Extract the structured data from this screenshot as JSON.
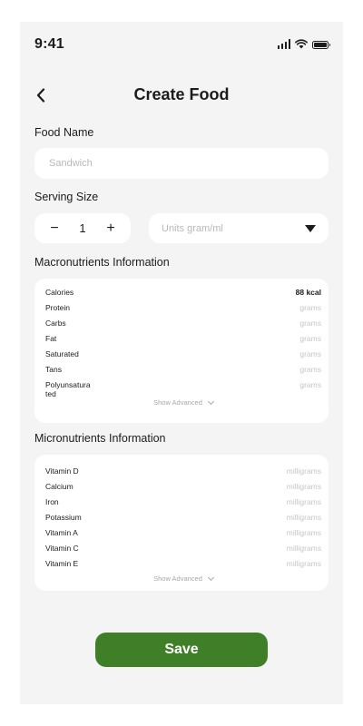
{
  "status_bar": {
    "time": "9:41"
  },
  "header": {
    "title": "Create Food"
  },
  "food_name": {
    "label": "Food Name",
    "placeholder": "Sandwich",
    "value": ""
  },
  "serving_size": {
    "label": "Serving Size",
    "decrement": "−",
    "quantity": "1",
    "increment": "+",
    "unit_placeholder": "Units gram/ml"
  },
  "macronutrients": {
    "label": "Macronutrients Information",
    "rows": [
      {
        "name": "Calories",
        "unit": "88 kcal"
      },
      {
        "name": "Protein",
        "unit": "grams"
      },
      {
        "name": "Carbs",
        "unit": "grams"
      },
      {
        "name": "Fat",
        "unit": "grams"
      },
      {
        "name": "Saturated",
        "unit": "grams"
      },
      {
        "name": "Tans",
        "unit": "grams"
      },
      {
        "name": "Polyunsatura ted",
        "unit": "grams"
      }
    ],
    "show_advanced": "Show Advanced"
  },
  "micronutrients": {
    "label": "Micronutrients Information",
    "rows": [
      {
        "name": "Vitamin D",
        "unit": "milligrams"
      },
      {
        "name": "Calcium",
        "unit": "milligrams"
      },
      {
        "name": "Iron",
        "unit": "milligrams"
      },
      {
        "name": "Potassium",
        "unit": "milligrams"
      },
      {
        "name": "Vitamin A",
        "unit": "milligrams"
      },
      {
        "name": "Vitamin C",
        "unit": "milligrams"
      },
      {
        "name": "Vitamin E",
        "unit": "milligrams"
      }
    ],
    "show_advanced": "Show Advanced"
  },
  "footer": {
    "save_label": "Save"
  },
  "colors": {
    "accent": "#3f7f28",
    "background": "#f4f4f5",
    "card": "#ffffff",
    "muted_text": "#c6c6cb"
  }
}
